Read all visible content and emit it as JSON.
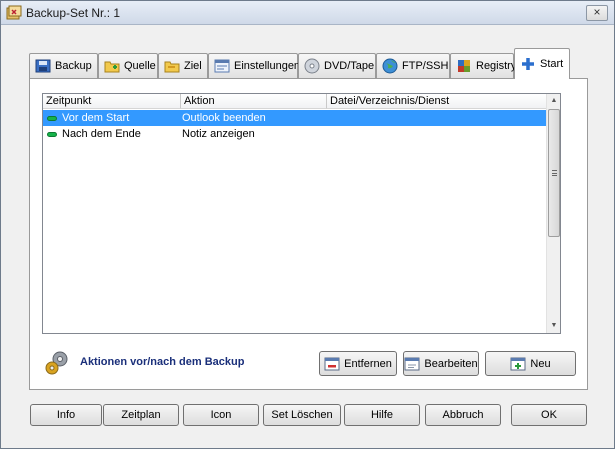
{
  "window": {
    "title": "Backup-Set Nr.: 1",
    "close_glyph": "×"
  },
  "tabs": [
    {
      "label": "Backup",
      "icon": "backup-icon"
    },
    {
      "label": "Quelle",
      "icon": "source-folder-icon"
    },
    {
      "label": "Ziel",
      "icon": "target-folder-icon"
    },
    {
      "label": "Einstellungen",
      "icon": "settings-icon"
    },
    {
      "label": "DVD/Tape",
      "icon": "disc-icon"
    },
    {
      "label": "FTP/SSH",
      "icon": "globe-icon"
    },
    {
      "label": "Registry",
      "icon": "registry-icon"
    },
    {
      "label": "Start",
      "icon": "plus-icon",
      "active": true
    }
  ],
  "list": {
    "columns": [
      "Zeitpunkt",
      "Aktion",
      "Datei/Verzeichnis/Dienst"
    ],
    "rows": [
      {
        "zeitpunkt": "Vor dem Start",
        "aktion": "Outlook beenden",
        "ziel": "",
        "selected": true
      },
      {
        "zeitpunkt": "Nach dem Ende",
        "aktion": "Notiz anzeigen",
        "ziel": "",
        "selected": false
      }
    ]
  },
  "panel_footer": {
    "label": "Aktionen vor/nach dem Backup",
    "remove_label": "Entfernen",
    "edit_label": "Bearbeiten",
    "new_label": "Neu"
  },
  "bottom_buttons": {
    "info": "Info",
    "zeitplan": "Zeitplan",
    "icon": "Icon",
    "set_loeschen": "Set Löschen",
    "hilfe": "Hilfe",
    "abbruch": "Abbruch",
    "ok": "OK"
  },
  "colors": {
    "selection": "#3399ff",
    "label_blue": "#1a2f7a",
    "status_green": "#16b34a"
  }
}
